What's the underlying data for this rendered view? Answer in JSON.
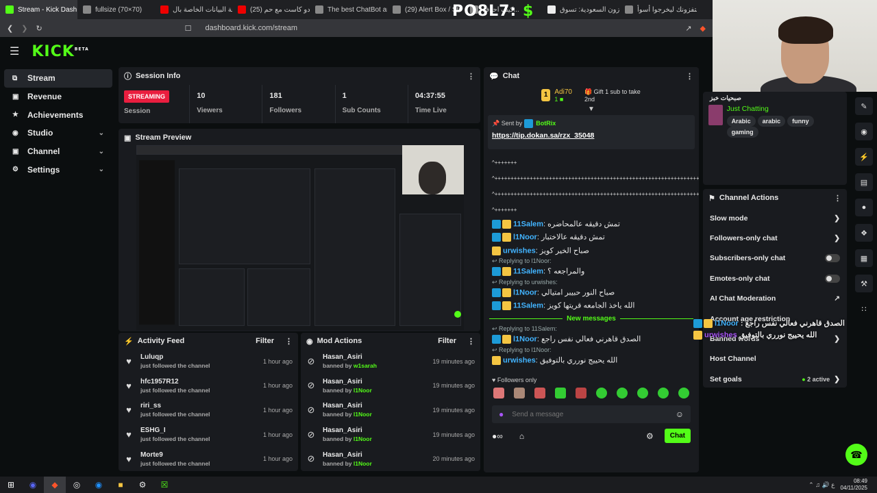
{
  "browser": {
    "tabs": [
      {
        "label": "Stream - Kick Dash",
        "color": "#53fc18",
        "active": true
      },
      {
        "label": "fullsize (70×70)",
        "color": "#888"
      },
      {
        "label": "لوحة البيانات الخاصة بال",
        "color": "#e00"
      },
      {
        "label": "(25) برودو كاست مع حم",
        "color": "#e00"
      },
      {
        "label": "The best ChatBot and",
        "color": "#888"
      },
      {
        "label": "(29) Alert Box / Str",
        "color": "#888"
      },
      {
        "label": "كيف احدف...",
        "color": "#888"
      },
      {
        "label": "أمازون السعودية: تسوق",
        "color": "#eee"
      },
      {
        "label": "يستفزونك ليخرجوا أسوأ",
        "color": "#888"
      }
    ],
    "url": "dashboard.kick.com/stream",
    "overlay": {
      "text": "PO8L7:",
      "symbol": "$"
    }
  },
  "app": {
    "logo": "KICK",
    "logo_sup": "BETA",
    "sidebar": [
      {
        "label": "Stream",
        "icon": "stream-icon",
        "active": true
      },
      {
        "label": "Revenue",
        "icon": "revenue-icon"
      },
      {
        "label": "Achievements",
        "icon": "trophy-icon"
      },
      {
        "label": "Studio",
        "icon": "studio-icon",
        "chevron": true
      },
      {
        "label": "Channel",
        "icon": "channel-icon",
        "chevron": true
      },
      {
        "label": "Settings",
        "icon": "gear-icon",
        "chevron": true
      }
    ]
  },
  "session": {
    "title": "Session Info",
    "badge": "STREAMING",
    "session_label": "Session",
    "stats": [
      {
        "value": "10",
        "label": "Viewers"
      },
      {
        "value": "181",
        "label": "Followers"
      },
      {
        "value": "1",
        "label": "Sub Counts"
      },
      {
        "value": "04:37:55",
        "label": "Time Live"
      }
    ]
  },
  "preview": {
    "title": "Stream Preview"
  },
  "activity": {
    "title": "Activity Feed",
    "filter": "Filter",
    "items": [
      {
        "name": "Luluqp",
        "desc": "just followed the channel",
        "time": "1 hour ago"
      },
      {
        "name": "hfc1957R12",
        "desc": "just followed the channel",
        "time": "1 hour ago"
      },
      {
        "name": "riri_ss",
        "desc": "just followed the channel",
        "time": "1 hour ago"
      },
      {
        "name": "ESHG_I",
        "desc": "just followed the channel",
        "time": "1 hour ago"
      },
      {
        "name": "Morte9",
        "desc": "just followed the channel",
        "time": "1 hour ago"
      }
    ]
  },
  "mod": {
    "title": "Mod Actions",
    "filter": "Filter",
    "items": [
      {
        "name": "Hasan_Asiri",
        "prefix": "banned by",
        "by": "w1sarah",
        "time": "19 minutes ago"
      },
      {
        "name": "Hasan_Asiri",
        "prefix": "banned by",
        "by": "l1Noor",
        "time": "19 minutes ago"
      },
      {
        "name": "Hasan_Asiri",
        "prefix": "banned by",
        "by": "l1Noor",
        "time": "19 minutes ago"
      },
      {
        "name": "Hasan_Asiri",
        "prefix": "banned by",
        "by": "l1Noor",
        "time": "19 minutes ago"
      },
      {
        "name": "Hasan_Asiri",
        "prefix": "banned by",
        "by": "l1Noor",
        "time": "20 minutes ago"
      }
    ]
  },
  "chat": {
    "title": "Chat",
    "top_user": "Adi70",
    "top_count": "1",
    "gift_text": "Gift 1 sub to take 2nd",
    "pinned_by_label": "Sent by",
    "pinned_by": "BotRix",
    "pinned_link": "https://tip.dokan.sa/rzx_35048",
    "spam_lines": [
      "^+++++++",
      "^+++++++++++++++++++++++++++++++++++++++++++++++++++++++++++++++++",
      "^+++++++++++++++++++++++++++++++++++++++++++++++++++++++++++++++++",
      "^+++++++"
    ],
    "messages": [
      {
        "reply": "",
        "user": "11Salem",
        "text": "تمش دقيقه عالمحاضره",
        "badges": "both"
      },
      {
        "reply": "",
        "user": "l1Noor",
        "text": "تمش دقيقه عالاختبار",
        "badges": "both"
      },
      {
        "reply": "",
        "user": "urwishes",
        "text": "صباح الخير كويز",
        "badges": "gold"
      },
      {
        "reply": "Replying to l1Noor:",
        "user": "11Salem",
        "text": "والمراجعه ؟",
        "badges": "both"
      },
      {
        "reply": "Replying to urwishes:",
        "user": "l1Noor",
        "text": "صباح النور حبيبر امتيالي",
        "badges": "both"
      },
      {
        "reply": "",
        "user": "11Salem",
        "text": "الله ياخذ الجامعه قريتها كويز",
        "badges": "both"
      }
    ],
    "new_messages": "New messages",
    "messages2": [
      {
        "reply": "Replying to 11Salem:",
        "user": "l1Noor",
        "text": "الصدق قاهرني فعالي نفس راجع",
        "badges": "both"
      },
      {
        "reply": "Replying to l1Noor:",
        "user": "urwishes",
        "text": "الله يحييج نورري بالتوفيق",
        "badges": "gold"
      }
    ],
    "followers_only": "Followers only",
    "placeholder": "Send a message",
    "send_label": "Chat"
  },
  "info": {
    "title": "صبحيات خبز",
    "category": "Just Chatting",
    "tags": [
      "Arabic",
      "arabic",
      "funny",
      "gaming"
    ]
  },
  "channel_actions": {
    "title": "Channel Actions",
    "items": [
      {
        "label": "Slow mode",
        "control": "chevron"
      },
      {
        "label": "Followers-only chat",
        "control": "chevron"
      },
      {
        "label": "Subscribers-only chat",
        "control": "toggle"
      },
      {
        "label": "Emotes-only chat",
        "control": "toggle"
      },
      {
        "label": "AI Chat Moderation",
        "control": "external"
      },
      {
        "label": "Account age restriction",
        "control": ""
      },
      {
        "label": "Banned words",
        "control": "chevron"
      },
      {
        "label": "Host Channel",
        "control": ""
      },
      {
        "label": "Set goals",
        "control": "chevron",
        "extra": "2 active"
      }
    ]
  },
  "overlay_chat": [
    {
      "user": "l1Noor",
      "text": "الصدق قاهرني فعالي نفس راجع"
    },
    {
      "user": "urwishes",
      "text": "الله يحييج نورري بالتوفيق"
    }
  ],
  "taskbar": {
    "time": "08:49",
    "date": "04/11/2025",
    "lang": "ع"
  }
}
